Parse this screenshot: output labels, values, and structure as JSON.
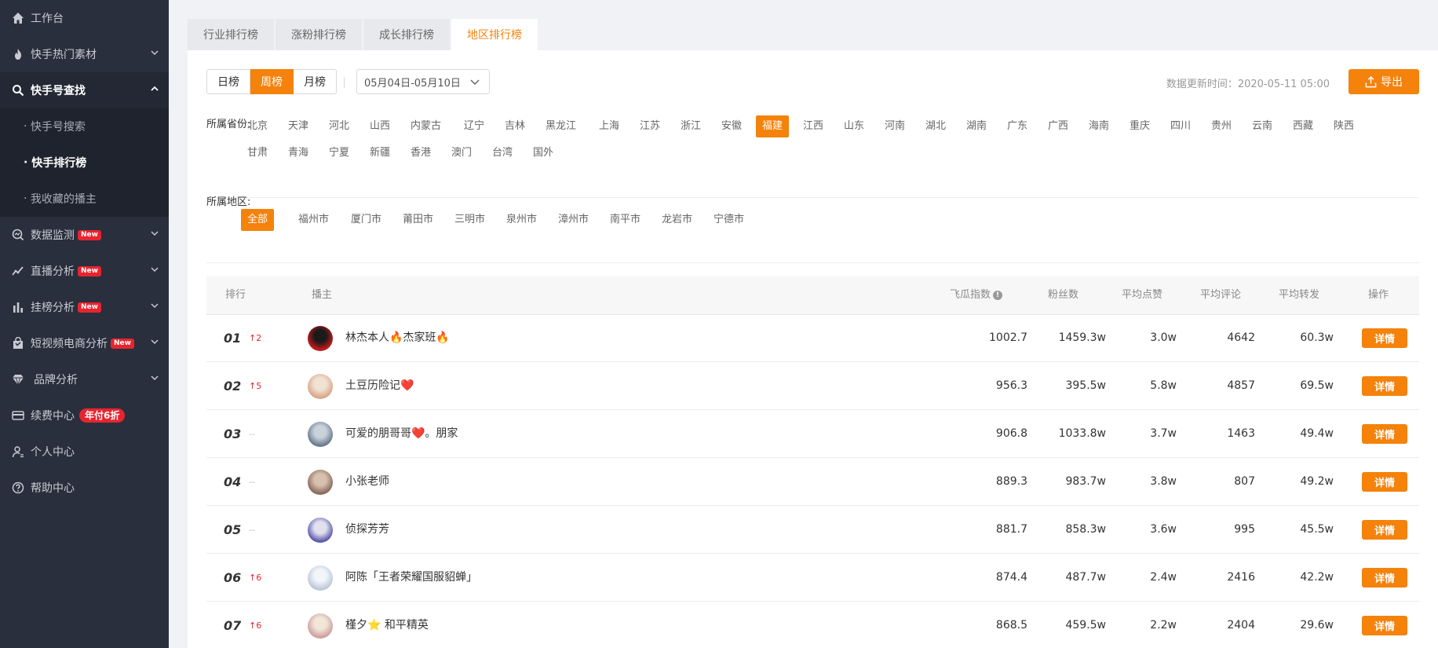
{
  "sidebar": {
    "items": [
      {
        "label": "工作台",
        "icon": "home-icon"
      },
      {
        "label": "快手热门素材",
        "icon": "fire-icon"
      },
      {
        "label": "快手号查找",
        "icon": "search-icon"
      },
      {
        "label": "快手号搜索"
      },
      {
        "label": "快手排行榜"
      },
      {
        "label": "我收藏的播主"
      },
      {
        "label": "数据监测",
        "icon": "monitor-icon",
        "badge": "New"
      },
      {
        "label": "直播分析",
        "icon": "trend-icon",
        "badge": "New"
      },
      {
        "label": "挂榜分析",
        "icon": "bar-chart-icon",
        "badge": "New"
      },
      {
        "label": "短视频电商分析",
        "icon": "shopping-bag-icon",
        "badge": "New"
      },
      {
        "label": "品牌分析",
        "icon": "diamond-icon"
      },
      {
        "label": "续费中心",
        "icon": "card-icon",
        "badge": "年付6折"
      },
      {
        "label": "个人中心",
        "icon": "user-icon"
      },
      {
        "label": "帮助中心",
        "icon": "help-icon"
      }
    ]
  },
  "tabs": [
    "行业排行榜",
    "涨粉排行榜",
    "成长排行榜",
    "地区排行榜"
  ],
  "period": {
    "options": [
      "日榜",
      "周榜",
      "月榜"
    ],
    "selected": "周榜"
  },
  "date_range": "05月04日-05月10日",
  "update_time": "数据更新时间：2020-05-11 05:00",
  "export_label": "导出",
  "province": {
    "label": "所属省份:",
    "selected": "福建",
    "options": [
      "北京",
      "天津",
      "河北",
      "山西",
      "内蒙古",
      "辽宁",
      "吉林",
      "黑龙江",
      "上海",
      "江苏",
      "浙江",
      "安徽",
      "福建",
      "江西",
      "山东",
      "河南",
      "湖北",
      "湖南",
      "广东",
      "广西",
      "海南",
      "重庆",
      "四川",
      "贵州",
      "云南",
      "西藏",
      "陕西",
      "甘肃",
      "青海",
      "宁夏",
      "新疆",
      "香港",
      "澳门",
      "台湾",
      "国外"
    ]
  },
  "region": {
    "label": "所属地区:",
    "selected": "全部",
    "options": [
      "全部",
      "福州市",
      "厦门市",
      "莆田市",
      "三明市",
      "泉州市",
      "漳州市",
      "南平市",
      "龙岩市",
      "宁德市"
    ]
  },
  "table": {
    "headers": {
      "rank": "排行",
      "host": "播主",
      "index": "飞瓜指数",
      "fans": "粉丝数",
      "likes": "平均点赞",
      "comments": "平均评论",
      "shares": "平均转发",
      "action": "操作"
    },
    "detail_label": "详情",
    "rows": [
      {
        "rank": "01",
        "delta": "↑2",
        "name": "林杰本人🔥杰家班🔥",
        "index": "1002.7",
        "fans": "1459.3w",
        "likes": "3.0w",
        "comments": "4642",
        "shares": "60.3w"
      },
      {
        "rank": "02",
        "delta": "↑5",
        "name": "土豆历险记❤️",
        "index": "956.3",
        "fans": "395.5w",
        "likes": "5.8w",
        "comments": "4857",
        "shares": "69.5w"
      },
      {
        "rank": "03",
        "delta": "--",
        "name": "可爱的朋哥哥❤️。朋家",
        "index": "906.8",
        "fans": "1033.8w",
        "likes": "3.7w",
        "comments": "1463",
        "shares": "49.4w"
      },
      {
        "rank": "04",
        "delta": "--",
        "name": "小张老师",
        "index": "889.3",
        "fans": "983.7w",
        "likes": "3.8w",
        "comments": "807",
        "shares": "49.2w"
      },
      {
        "rank": "05",
        "delta": "--",
        "name": "侦探芳芳",
        "index": "881.7",
        "fans": "858.3w",
        "likes": "3.6w",
        "comments": "995",
        "shares": "45.5w"
      },
      {
        "rank": "06",
        "delta": "↑6",
        "name": "阿陈「王者荣耀国服貂蝉」",
        "index": "874.4",
        "fans": "487.7w",
        "likes": "2.4w",
        "comments": "2416",
        "shares": "42.2w"
      },
      {
        "rank": "07",
        "delta": "↑6",
        "name": "槿夕⭐ 和平精英",
        "index": "868.5",
        "fans": "459.5w",
        "likes": "2.2w",
        "comments": "2404",
        "shares": "29.6w"
      }
    ]
  },
  "colors": {
    "accent": "#f5820a",
    "sidebar_bg": "#2a2f3d",
    "badge_red": "#e8242f"
  }
}
